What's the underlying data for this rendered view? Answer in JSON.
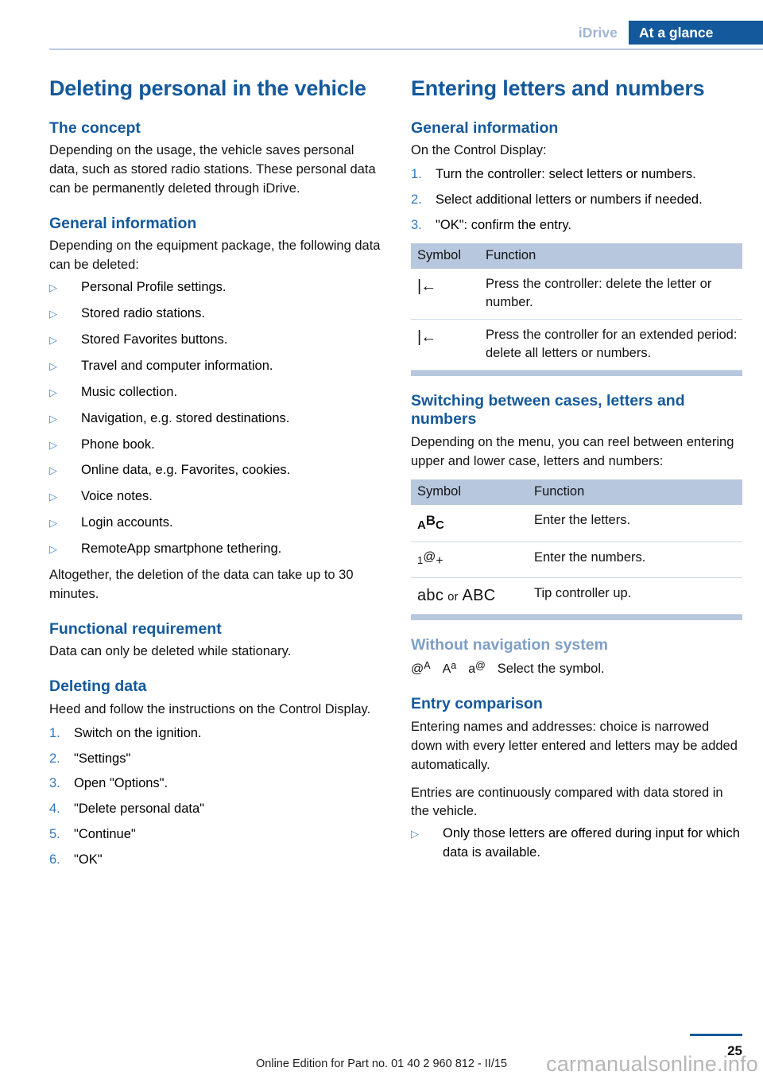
{
  "header": {
    "section": "iDrive",
    "chapter": "At a glance"
  },
  "left_column": {
    "title": "Deleting personal in the vehicle",
    "concept": {
      "heading": "The concept",
      "paragraph": "Depending on the usage, the vehicle saves personal data, such as stored radio stations. These personal data can be permanently deleted through iDrive."
    },
    "general_information": {
      "heading": "General information",
      "intro": "Depending on the equipment package, the following data can be deleted:",
      "bullets": [
        "Personal Profile settings.",
        "Stored radio stations.",
        "Stored Favorites buttons.",
        "Travel and computer information.",
        "Music collection.",
        "Navigation, e.g. stored destinations.",
        "Phone book.",
        "Online data, e.g. Favorites, cookies.",
        "Voice notes.",
        "Login accounts.",
        "RemoteApp smartphone tethering."
      ],
      "outro": "Altogether, the deletion of the data can take up to 30 minutes."
    },
    "functional_requirement": {
      "heading": "Functional requirement",
      "paragraph": "Data can only be deleted while stationary."
    },
    "deleting_data": {
      "heading": "Deleting data",
      "intro": "Heed and follow the instructions on the Control Display.",
      "steps": [
        {
          "num": "1.",
          "text": "Switch on the ignition."
        },
        {
          "num": "2.",
          "text": "\"Settings\""
        },
        {
          "num": "3.",
          "text": "Open \"Options\"."
        },
        {
          "num": "4.",
          "text": "\"Delete personal data\""
        },
        {
          "num": "5.",
          "text": "\"Continue\""
        },
        {
          "num": "6.",
          "text": "\"OK\""
        }
      ]
    }
  },
  "right_column": {
    "title": "Entering letters and numbers",
    "general_information": {
      "heading": "General information",
      "intro": "On the Control Display:",
      "steps": [
        {
          "num": "1.",
          "text": "Turn the controller: select letters or numbers."
        },
        {
          "num": "2.",
          "text": "Select additional letters or numbers if needed."
        },
        {
          "num": "3.",
          "text": "\"OK\": confirm the entry."
        }
      ]
    },
    "delete_table": {
      "headers": [
        "Symbol",
        "Function"
      ],
      "rows": [
        {
          "symbol": "backspace-arrow",
          "function": "Press the controller: delete the letter or number."
        },
        {
          "symbol": "backspace-arrow",
          "function": "Press the controller for an extended period: delete all letters or numbers."
        }
      ]
    },
    "switching": {
      "heading": "Switching between cases, letters and numbers",
      "intro": "Depending on the menu, you can reel between entering upper and lower case, letters and numbers:",
      "table": {
        "headers": [
          "Symbol",
          "Function"
        ],
        "rows": [
          {
            "symbol": "ABC",
            "function": "Enter the letters."
          },
          {
            "symbol": "1@+",
            "function": "Enter the numbers."
          },
          {
            "symbol": "abc or ABC",
            "function": "Tip controller up."
          }
        ]
      }
    },
    "without_navigation": {
      "heading": "Without navigation system",
      "symbols": [
        "@A",
        "Aa",
        "a@"
      ],
      "text": "Select the symbol."
    },
    "entry_comparison": {
      "heading": "Entry comparison",
      "paragraph1": "Entering names and addresses: choice is narrowed down with every letter entered and letters may be added automatically.",
      "paragraph2": "Entries are continuously compared with data stored in the vehicle.",
      "bullets": [
        "Only those letters are offered during input for which data is available."
      ]
    }
  },
  "footer": {
    "note": "Online Edition for Part no. 01 40 2 960 812 - II/15",
    "page_number": "25",
    "watermark": "carmanualsonline.info"
  },
  "colors": {
    "brand_blue": "#14599c",
    "muted_blue": "#7e9ec4",
    "table_header": "#b7c7de",
    "bullet_blue": "#4a87c4"
  }
}
